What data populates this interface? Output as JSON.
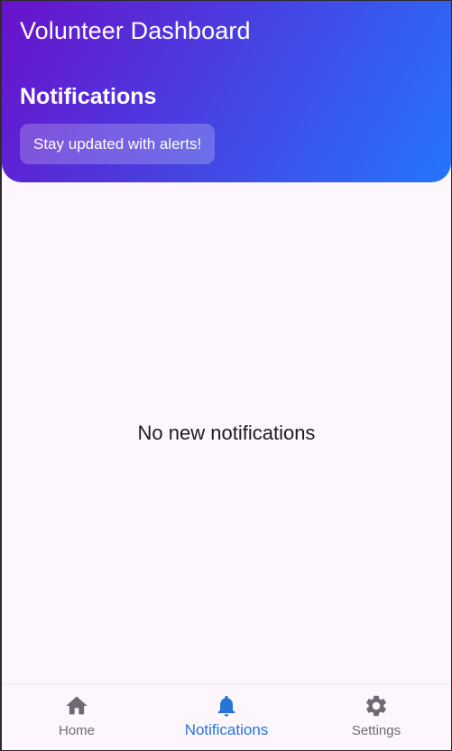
{
  "header": {
    "app_title": "Volunteer Dashboard",
    "section_title": "Notifications",
    "alert_chip": "Stay updated with alerts!"
  },
  "main": {
    "empty_message": "No new notifications"
  },
  "bottom_nav": {
    "items": [
      {
        "label": "Home",
        "icon": "home-icon",
        "active": false
      },
      {
        "label": "Notifications",
        "icon": "bell-icon",
        "active": true
      },
      {
        "label": "Settings",
        "icon": "gear-icon",
        "active": false
      }
    ]
  },
  "colors": {
    "gradient_start": "#6a11cb",
    "gradient_end": "#2575fc",
    "active_nav": "#2a73d8",
    "inactive_nav": "#6e6a73",
    "background": "#fdf7fd"
  }
}
